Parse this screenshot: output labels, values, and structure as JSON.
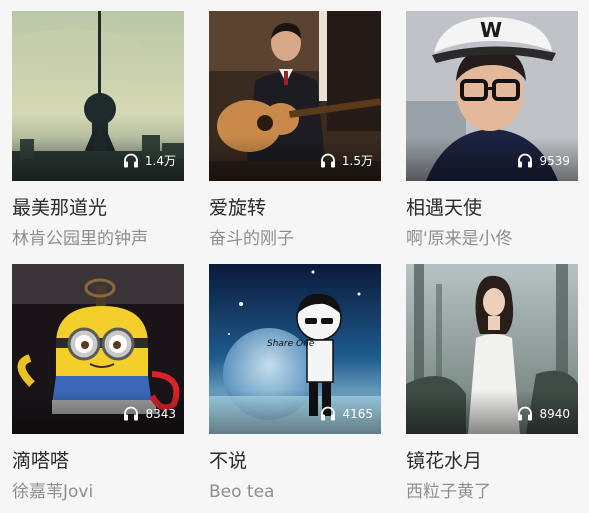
{
  "playlists": [
    {
      "title": "最美那道光",
      "artist": "林肯公园里的钟声",
      "plays": "1.4万",
      "icon": "headphones-icon"
    },
    {
      "title": "爱旋转",
      "artist": "奋斗的刚子",
      "plays": "1.5万",
      "icon": "headphones-icon"
    },
    {
      "title": "相遇天使",
      "artist": "啊'原来是小佟",
      "plays": "9539",
      "icon": "headphones-icon"
    },
    {
      "title": "滴嗒嗒",
      "artist": "徐嘉苇Jovi",
      "plays": "8343",
      "icon": "headphones-icon"
    },
    {
      "title": "不说",
      "artist": "Beo tea",
      "plays": "4165",
      "icon": "headphones-icon"
    },
    {
      "title": "镜花水月",
      "artist": "西粒子黄了",
      "plays": "8940",
      "icon": "headphones-icon"
    }
  ],
  "artwork_text": {
    "share_one": "Share One"
  }
}
